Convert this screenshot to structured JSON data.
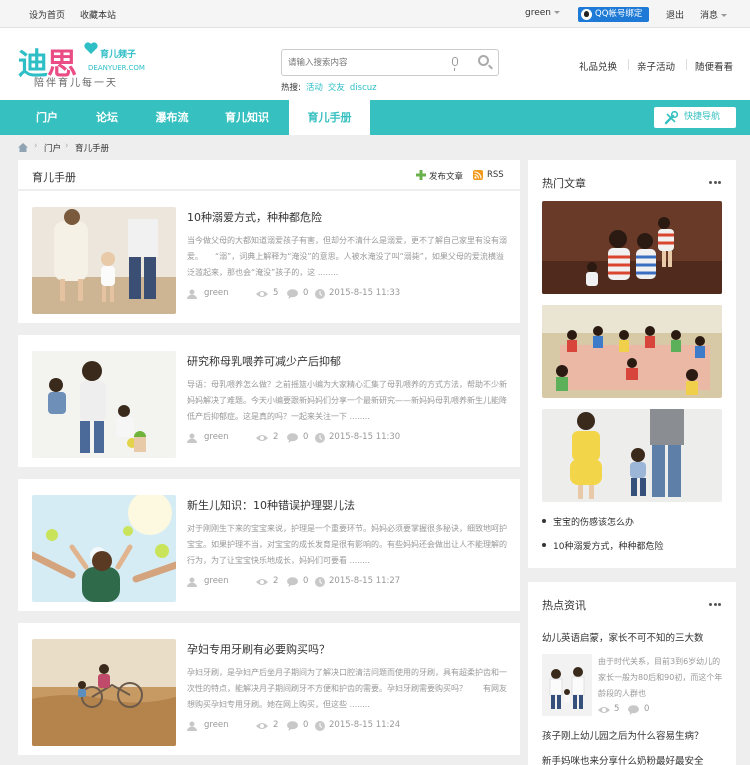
{
  "topbar": {
    "set_home": "设为首页",
    "bookmark": "收藏本站",
    "user": "green",
    "qq_bind": "QQ帐号绑定",
    "logout": "退出",
    "messages": "消息"
  },
  "logo": {
    "name_teal": "迪",
    "name_pink": "思",
    "sub_cn": "育儿频子",
    "sub_en": "DEANYUER.COM",
    "slogan": "陪伴育儿每一天"
  },
  "search": {
    "placeholder": "请输入搜索内容",
    "hot_label": "热搜:",
    "hot_terms": [
      "活动",
      "交友",
      "discuz"
    ]
  },
  "header_links": [
    "礼品兑换",
    "亲子活动",
    "随便看看"
  ],
  "nav": {
    "items": [
      "门户",
      "论坛",
      "瀑布流",
      "育儿知识",
      "育儿手册"
    ],
    "active_index": 4,
    "quick_nav": "快捷导航"
  },
  "breadcrumb": [
    "门户",
    "育儿手册"
  ],
  "panel": {
    "title": "育儿手册",
    "post_label": "发布文章",
    "rss_label": "RSS"
  },
  "articles": [
    {
      "title": "10种溺爱方式，种种都危险",
      "excerpt": "当今做父母的大都知道溺爱孩子有害，但却分不清什么是溺爱，更不了解自己家里有没有溺爱。　　“溺”，词典上解释为“淹没”的意思。人被水淹没了叫“溺毙”，如果父母的爱流横溢泛滥起来，那也会“淹没”孩子的，这 ........",
      "author": "green",
      "views": "5",
      "comments": "0",
      "date": "2015-8-15 11:33"
    },
    {
      "title": "研究称母乳喂养可减少产后抑郁",
      "excerpt": "导语：母乳喂养怎么做？之前摇篮小编为大家精心汇集了母乳喂养的方式方法，帮助不少新妈妈解决了难题。今天小编要跟新妈妈们分享一个最新研究——新妈妈母乳喂养新生儿能降低产后抑郁症。这是真的吗？一起来关注一下 ........",
      "author": "green",
      "views": "2",
      "comments": "0",
      "date": "2015-8-15 11:30"
    },
    {
      "title": "新生儿知识：10种错误护理婴儿法",
      "excerpt": "对于刚刚生下来的宝宝来说，护理是一个重要环节。妈妈必须要掌握很多秘诀，细致地呵护宝宝。如果护理不当，对宝宝的成长发育是很有影响的。有些妈妈还会做出让人不能理解的行为，为了让宝宝快乐地成长，妈妈们可要看 ........",
      "author": "green",
      "views": "2",
      "comments": "0",
      "date": "2015-8-15 11:27"
    },
    {
      "title": "孕妇专用牙刷有必要购买吗？",
      "excerpt": "孕妇牙刷，是孕妇产后坐月子期间为了解决口腔清洁问题而使用的牙刷，具有超柔护齿和一次性的特点，能解决月子期间刷牙不方便和护齿的需要。孕妇牙刷需要购买吗？　　有网友想购买孕妇专用牙刷。她在网上购买，但这些 ........",
      "author": "green",
      "views": "2",
      "comments": "0",
      "date": "2015-8-15 11:24"
    }
  ],
  "sidebar_hot": {
    "title": "热门文章",
    "links": [
      "宝宝的伤感该怎么办",
      "10种溺爱方式，种种都危险"
    ]
  },
  "sidebar_news": {
    "title": "热点资讯",
    "item1_title": "幼儿英语启蒙，家长不可不知的三大数",
    "item1_excerpt": "由于时代关系，目前3到6岁幼儿的家长一般为80后和90初，而这个年龄段的人群也",
    "item1_views": "5",
    "item1_comments": "0",
    "item2_title": "孩子刚上幼儿园之后为什么容易生病？",
    "item3_title": "新手妈咪也来分享什么奶粉最好最安全"
  }
}
